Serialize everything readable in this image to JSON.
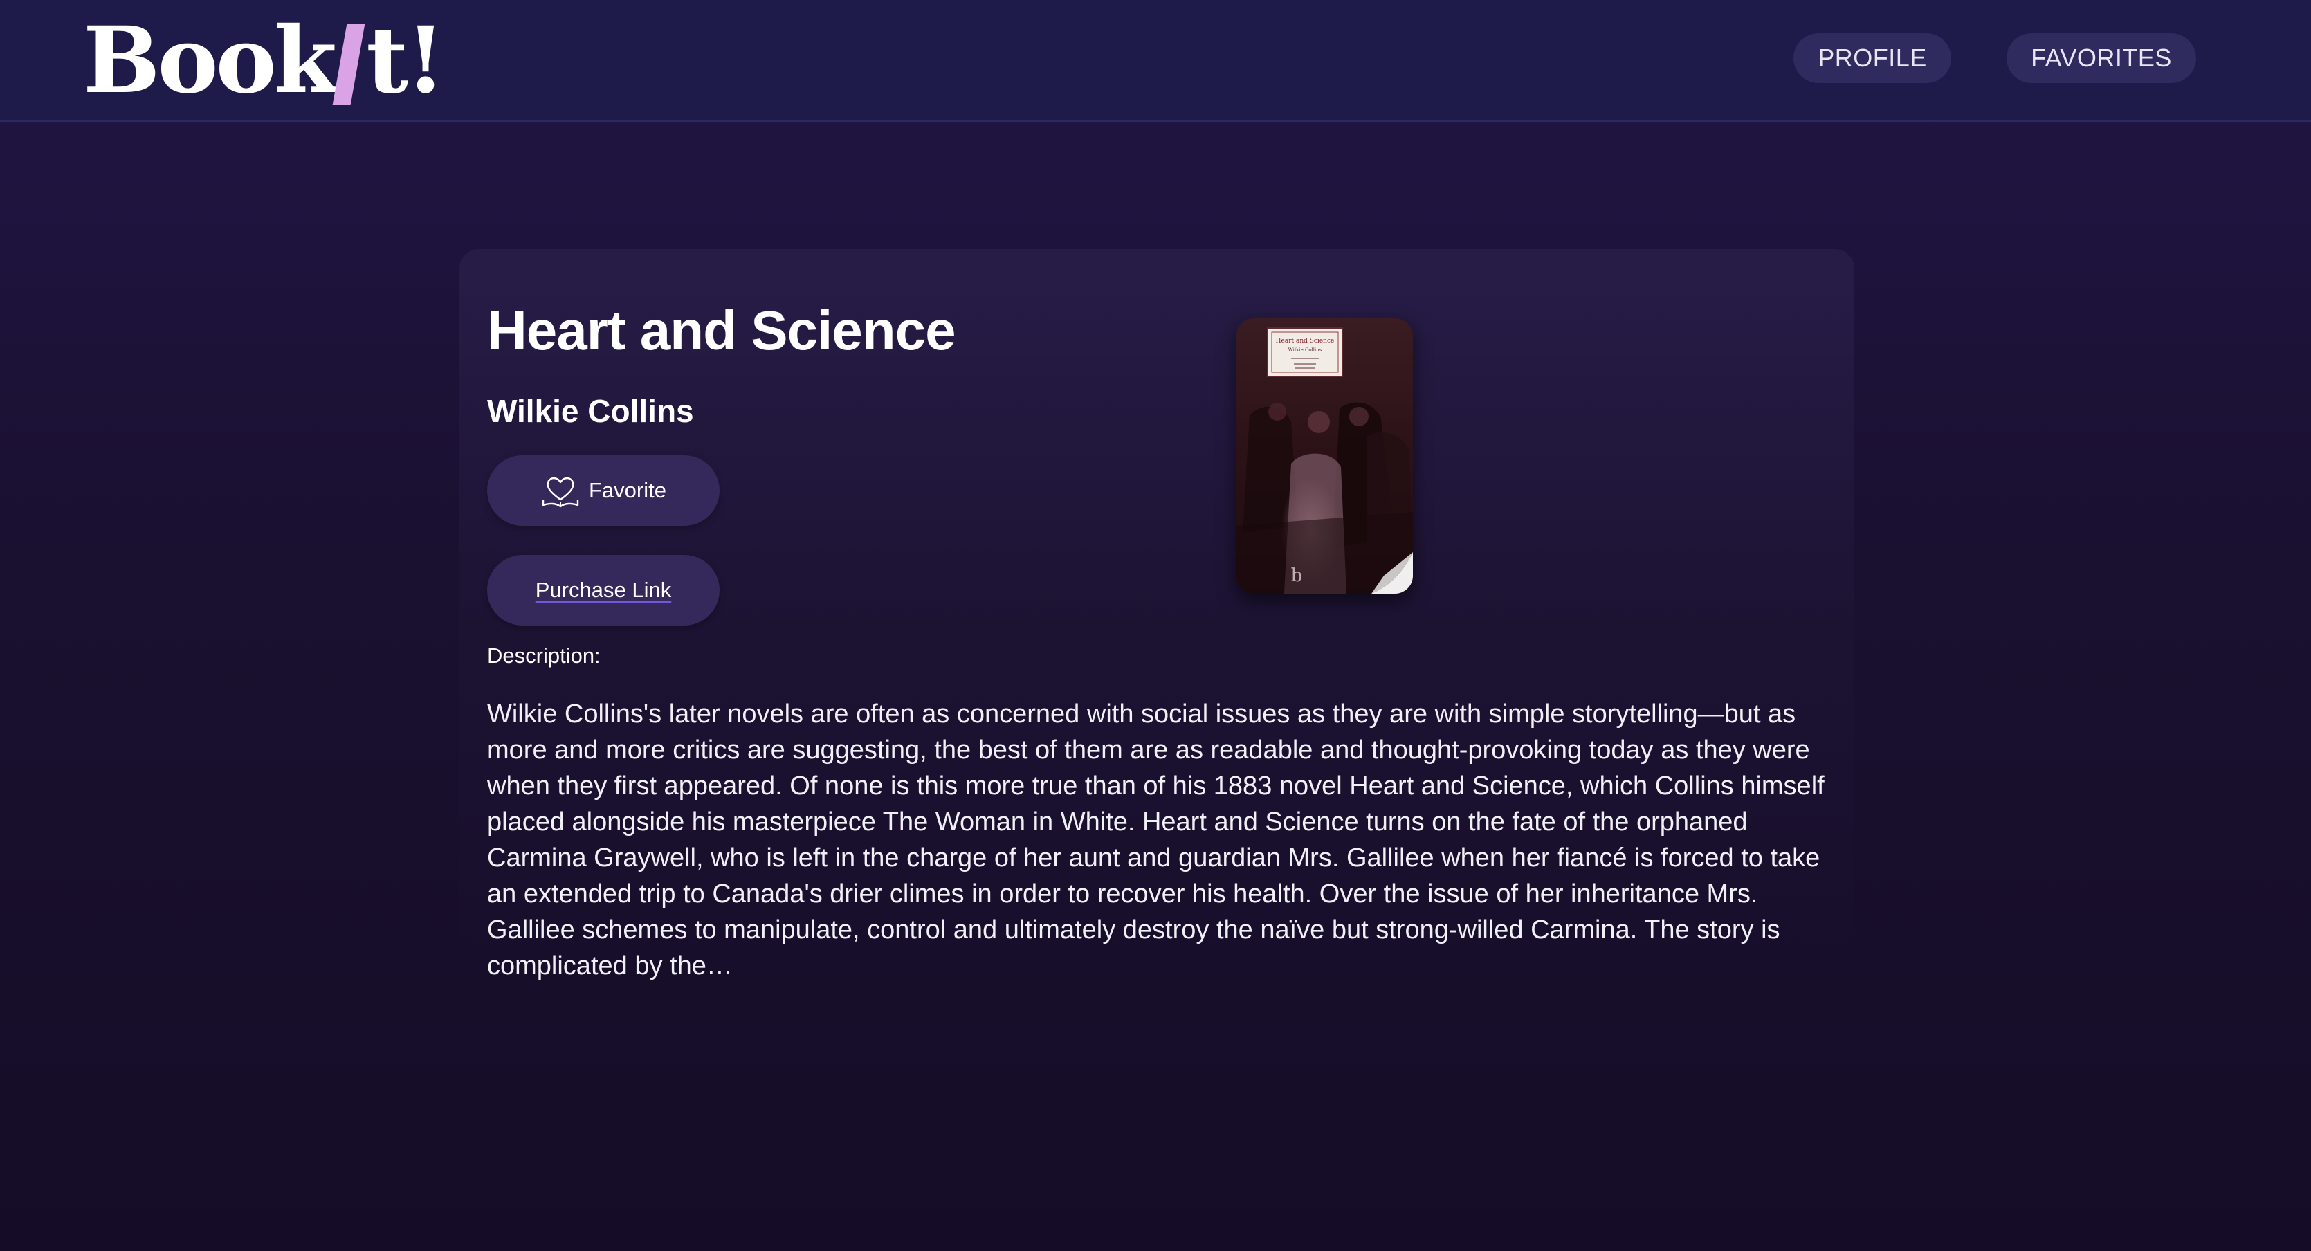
{
  "header": {
    "logo_left": "Book",
    "logo_right": "t!",
    "nav": {
      "profile_label": "PROFILE",
      "favorites_label": "FAVORITES"
    }
  },
  "book": {
    "title": "Heart and Science",
    "author": "Wilkie Collins",
    "favorite_label": "Favorite",
    "purchase_label": "Purchase Link",
    "description_label": "Description:",
    "description": "Wilkie Collins's later novels are often as concerned with social issues as they are with simple storytelling—but as more and more critics are suggesting, the best of them are as readable and thought-provoking today as they were when they first appeared. Of none is this more true than of his 1883 novel Heart and Science, which Collins himself placed alongside his masterpiece The Woman in White. Heart and Science turns on the fate of the orphaned Carmina Graywell, who is left in the charge of her aunt and guardian Mrs. Gallilee when her fiancé is forced to take an extended trip to Canada's drier climes in order to recover his health. Over the issue of her inheritance Mrs. Gallilee schemes to manipulate, control and ultimately destroy the naïve but strong-willed Carmina. The story is complicated by the…",
    "cover": {
      "title": "Heart and Science",
      "author": "Wilkie Collins",
      "icon": "book-cover-image"
    }
  },
  "colors": {
    "header_bg": "#1e1b4b",
    "nav_pill": "#2f2b5e",
    "button_bg": "#35285a",
    "logo_accent": "#d9a3e6",
    "page_bg": "#1a1030"
  }
}
